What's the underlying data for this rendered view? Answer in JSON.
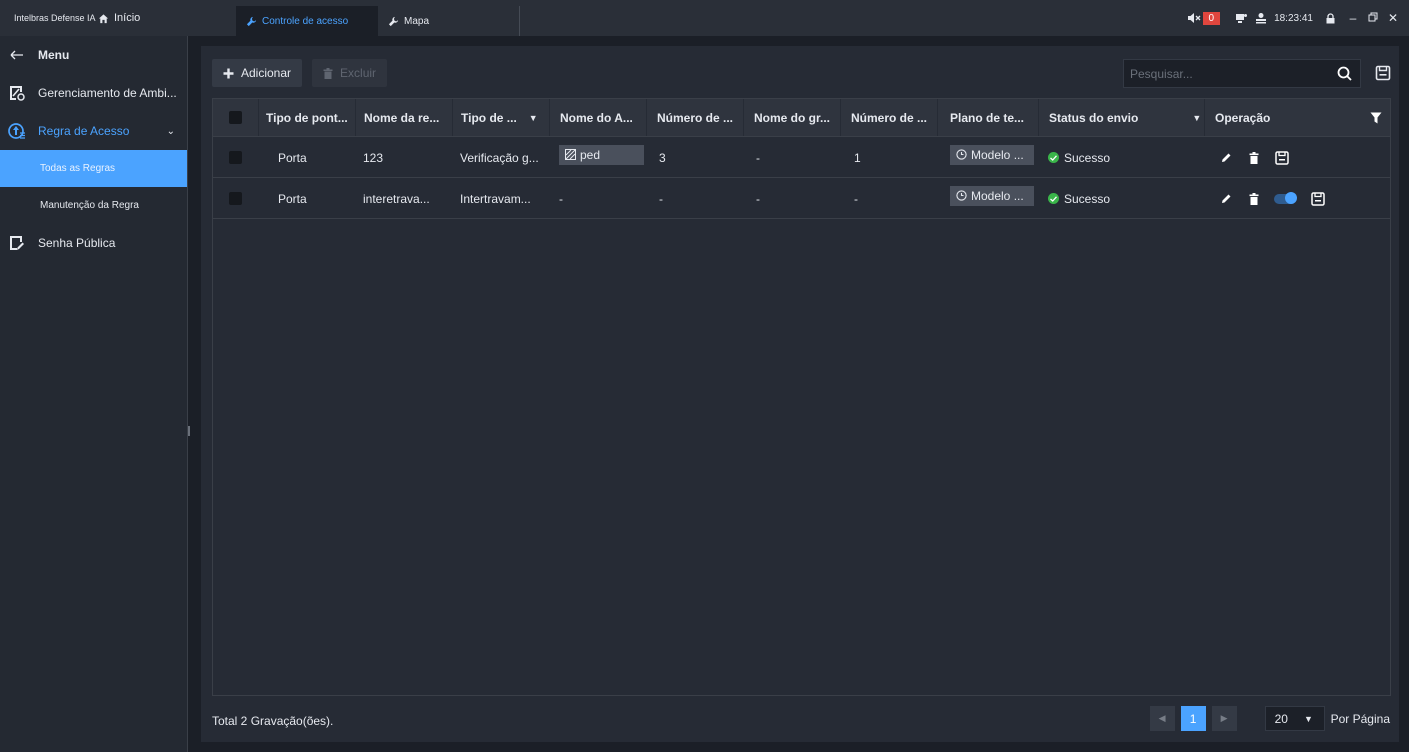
{
  "titlebar": {
    "brand": "Intelbras Defense IA",
    "home_label": "Início",
    "tabs": [
      {
        "label": "Controle de acesso",
        "active": true
      },
      {
        "label": "Mapa",
        "active": false
      }
    ],
    "alarm_count": "0",
    "clock": "18:23:41"
  },
  "sidebar": {
    "menu_label": "Menu",
    "items": [
      {
        "label": "Gerenciamento de Ambi..."
      },
      {
        "label": "Regra de Acesso"
      },
      {
        "label": "Senha Pública"
      }
    ],
    "subitems": [
      {
        "label": "Todas as Regras",
        "active": true
      },
      {
        "label": "Manutenção da Regra",
        "active": false
      }
    ]
  },
  "toolbar": {
    "add_label": "Adicionar",
    "delete_label": "Excluir",
    "search_placeholder": "Pesquisar..."
  },
  "table": {
    "columns": [
      "Tipo de pont...",
      "Nome da re...",
      "Tipo de ...",
      "Nome do A...",
      "Número de ...",
      "Nome do gr...",
      "Número de ...",
      "Plano de te...",
      "Status do envio",
      "Operação"
    ],
    "rows": [
      {
        "tipo_ponto": "Porta",
        "nome_regra": "123",
        "tipo": "Verificação g...",
        "nome_a": "ped",
        "numero1": "3",
        "nome_grupo": "-",
        "numero2": "1",
        "plano": "Modelo ...",
        "status": "Sucesso"
      },
      {
        "tipo_ponto": "Porta",
        "nome_regra": "interetrava...",
        "tipo": "Intertravam...",
        "nome_a": "-",
        "numero1": "-",
        "nome_grupo": "-",
        "numero2": "-",
        "plano": "Modelo ...",
        "status": "Sucesso"
      }
    ]
  },
  "footer": {
    "total": "Total 2 Gravação(ões).",
    "current_page": "1",
    "page_size": "20",
    "per_page_label": "Por Página"
  },
  "colors": {
    "accent": "#4ba3ff",
    "success": "#3ab54a",
    "alarm": "#e0463e"
  }
}
